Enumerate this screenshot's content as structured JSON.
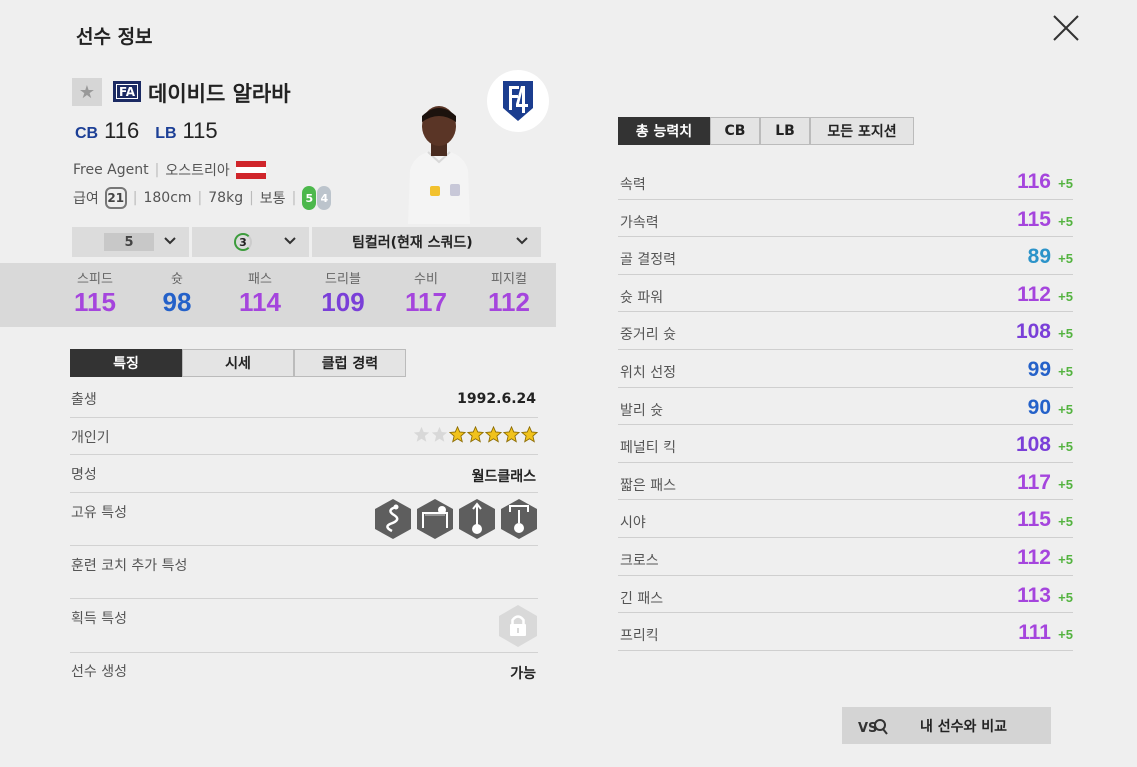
{
  "window": {
    "title": "선수 정보"
  },
  "player": {
    "name": "데이비드 알라바",
    "club_badge": "FA",
    "positions": [
      {
        "pos": "CB",
        "ovr": "116"
      },
      {
        "pos": "LB",
        "ovr": "115"
      }
    ],
    "team": "Free Agent",
    "nation": "오스트리아",
    "salary_label": "급여",
    "salary": "21",
    "height": "180cm",
    "weight": "78kg",
    "body": "보통",
    "foot_left": "5",
    "foot_right": "4"
  },
  "selectors": {
    "level": "5",
    "training": "3",
    "team_color": "팀컬러(현재 스쿼드)"
  },
  "summary_stats": [
    {
      "label": "스피드",
      "value": "115",
      "color": "#a545dd"
    },
    {
      "label": "슛",
      "value": "98",
      "color": "#2461c9"
    },
    {
      "label": "패스",
      "value": "114",
      "color": "#a545dd"
    },
    {
      "label": "드리블",
      "value": "109",
      "color": "#7a3fd8"
    },
    {
      "label": "수비",
      "value": "117",
      "color": "#a545dd"
    },
    {
      "label": "피지컬",
      "value": "112",
      "color": "#a545dd"
    }
  ],
  "left_tabs": [
    "특징",
    "시세",
    "클럽 경력"
  ],
  "info": {
    "birth_label": "출생",
    "birth": "1992.6.24",
    "skill_label": "개인기",
    "skill_stars": 5,
    "skill_max": 7,
    "fame_label": "명성",
    "fame": "월드클래스",
    "traits_label": "고유 특성",
    "traits": [
      "dribble-trait-icon",
      "goalkeeper-trait-icon",
      "long-shot-trait-icon",
      "finesse-trait-icon"
    ],
    "coach_label": "훈련 코치 추가 특성",
    "acquired_label": "획득 특성",
    "creation_label": "선수 생성",
    "creation": "가능"
  },
  "right_tabs": [
    "총 능력치",
    "CB",
    "LB",
    "모든 포지션"
  ],
  "abilities": [
    {
      "label": "속력",
      "value": "116",
      "bonus": "+5",
      "color": "#a545dd"
    },
    {
      "label": "가속력",
      "value": "115",
      "bonus": "+5",
      "color": "#a545dd"
    },
    {
      "label": "골 결정력",
      "value": "89",
      "bonus": "+5",
      "color": "#2b93c9"
    },
    {
      "label": "슛 파워",
      "value": "112",
      "bonus": "+5",
      "color": "#a545dd"
    },
    {
      "label": "중거리 슛",
      "value": "108",
      "bonus": "+5",
      "color": "#7a3fd8"
    },
    {
      "label": "위치 선정",
      "value": "99",
      "bonus": "+5",
      "color": "#2461c9"
    },
    {
      "label": "발리 슛",
      "value": "90",
      "bonus": "+5",
      "color": "#2461c9"
    },
    {
      "label": "페널티 킥",
      "value": "108",
      "bonus": "+5",
      "color": "#7a3fd8"
    },
    {
      "label": "짧은 패스",
      "value": "117",
      "bonus": "+5",
      "color": "#a545dd"
    },
    {
      "label": "시야",
      "value": "115",
      "bonus": "+5",
      "color": "#a545dd"
    },
    {
      "label": "크로스",
      "value": "112",
      "bonus": "+5",
      "color": "#a545dd"
    },
    {
      "label": "긴 패스",
      "value": "113",
      "bonus": "+5",
      "color": "#a545dd"
    },
    {
      "label": "프리킥",
      "value": "111",
      "bonus": "+5",
      "color": "#a545dd"
    }
  ],
  "compare_button": "내 선수와 비교"
}
